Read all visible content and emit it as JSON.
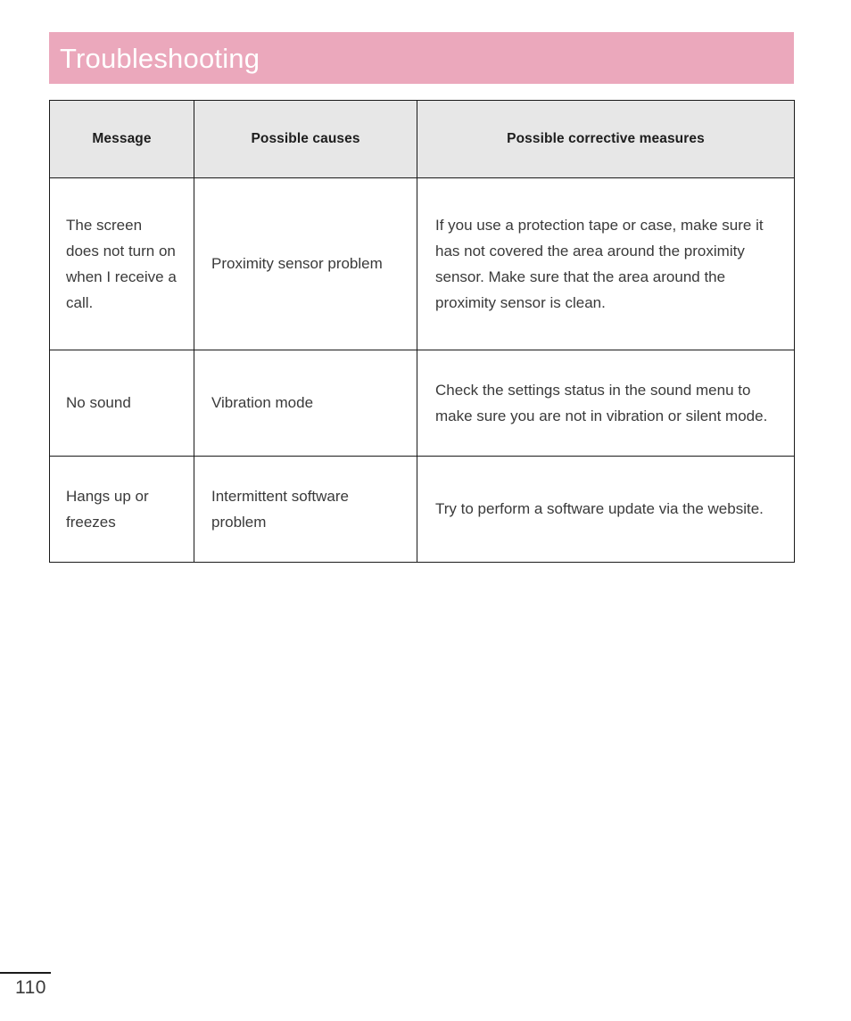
{
  "page": {
    "title": "Troubleshooting",
    "number": "110",
    "banner_color": "#EBA8BC",
    "header_row_color": "#E7E7E7",
    "border_color": "#1A1A1A",
    "body_text_color": "#3A3A3A"
  },
  "table": {
    "headers": [
      "Message",
      "Possible causes",
      "Possible corrective measures"
    ],
    "rows": [
      {
        "message": "The screen does not turn on when I receive a call.",
        "cause": "Proximity sensor problem",
        "measure": "If you use a protection tape or case, make sure it has not covered the area around the proximity sensor. Make sure that the area around the proximity sensor is clean."
      },
      {
        "message": "No sound",
        "cause": "Vibration mode",
        "measure": "Check the settings status in the sound menu to make sure you are not in vibration or silent mode."
      },
      {
        "message": "Hangs up or freezes",
        "cause": "Intermittent software problem",
        "measure": "Try to perform a software update via the website."
      }
    ]
  }
}
